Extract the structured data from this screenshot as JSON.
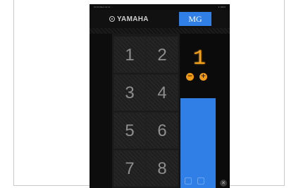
{
  "statusbar": {
    "left_text": "10:04  Wed Jul 14  ...",
    "right_text": "● 100%"
  },
  "header": {
    "brand": "YAMAHA",
    "mode_button": "MG"
  },
  "pads": [
    {
      "label": "1"
    },
    {
      "label": "2"
    },
    {
      "label": "3"
    },
    {
      "label": "4"
    },
    {
      "label": "5"
    },
    {
      "label": "6"
    },
    {
      "label": "7"
    },
    {
      "label": "8"
    }
  ],
  "display": {
    "value": "1"
  },
  "controls": {
    "minus": "−",
    "plus": "+",
    "corner": "✕"
  },
  "colors": {
    "accent": "#2f7fe6",
    "indicator": "#f5a21b",
    "background": "#0d0d0d"
  }
}
